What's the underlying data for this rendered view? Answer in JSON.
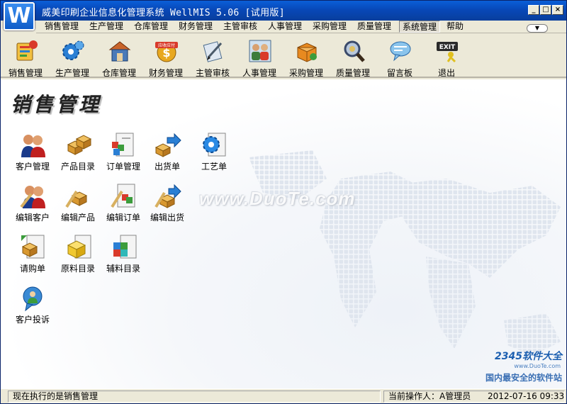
{
  "window": {
    "logo_letter": "W",
    "title": "威美印刷企业信息化管理系统   WellMIS 5.06 [试用版]",
    "minimize_label": "_",
    "maximize_label": "□",
    "close_label": "×"
  },
  "menu": {
    "items": [
      {
        "label": "销售管理"
      },
      {
        "label": "生产管理"
      },
      {
        "label": "仓库管理"
      },
      {
        "label": "财务管理"
      },
      {
        "label": "主管审核"
      },
      {
        "label": "人事管理"
      },
      {
        "label": "采购管理"
      },
      {
        "label": "质量管理"
      },
      {
        "label": "系统管理"
      },
      {
        "label": "帮助"
      }
    ],
    "active_index": 8
  },
  "toolbar": {
    "items": [
      {
        "label": "销售管理",
        "icon": "sales-icon",
        "color": "#d93a2b"
      },
      {
        "label": "生产管理",
        "icon": "gear-production-icon",
        "color": "#2a7fd4"
      },
      {
        "label": "仓库管理",
        "icon": "warehouse-icon",
        "color": "#c8642a"
      },
      {
        "label": "财务管理",
        "icon": "finance-icon",
        "color": "#e8a820"
      },
      {
        "label": "主管审核",
        "icon": "review-icon",
        "color": "#6a8fb0"
      },
      {
        "label": "人事管理",
        "icon": "personnel-icon",
        "color": "#3c7c3c"
      },
      {
        "label": "采购管理",
        "icon": "purchase-icon",
        "color": "#e88a20"
      },
      {
        "label": "质量管理",
        "icon": "quality-icon",
        "color": "#7a8ea8"
      },
      {
        "label": "留言板",
        "icon": "message-board-icon",
        "color": "#5aa0d8"
      },
      {
        "label": "退出",
        "icon": "exit-icon",
        "color": "#e0c020"
      }
    ],
    "finance_badge": "应收应付",
    "exit_badge": "EXIT"
  },
  "main": {
    "page_title": "销售管理",
    "watermark": "www.DuoTe.com",
    "functions": [
      {
        "label": "客户管理",
        "icon": "customers-icon"
      },
      {
        "label": "产品目录",
        "icon": "product-catalog-icon"
      },
      {
        "label": "订单管理",
        "icon": "order-icon"
      },
      {
        "label": "出货单",
        "icon": "shipping-icon"
      },
      {
        "label": "工艺单",
        "icon": "process-sheet-icon"
      },
      {
        "label": "编辑客户",
        "icon": "edit-customer-icon"
      },
      {
        "label": "编辑产品",
        "icon": "edit-product-icon"
      },
      {
        "label": "编辑订单",
        "icon": "edit-order-icon"
      },
      {
        "label": "编辑出货",
        "icon": "edit-shipping-icon"
      },
      {
        "label": "请购单",
        "icon": "requisition-icon"
      },
      {
        "label": "原料目录",
        "icon": "raw-material-icon"
      },
      {
        "label": "辅料目录",
        "icon": "auxiliary-material-icon"
      },
      {
        "label": "客户投诉",
        "icon": "complaint-icon"
      }
    ],
    "corner_logo": {
      "top": "2345软件大全",
      "mid": "www.DuoTe.com",
      "bottom": "国内最安全的软件站"
    }
  },
  "status": {
    "current_task": "现在执行的是销售管理",
    "operator": "当前操作人：A管理员",
    "datetime": "2012-07-16 09:33"
  }
}
